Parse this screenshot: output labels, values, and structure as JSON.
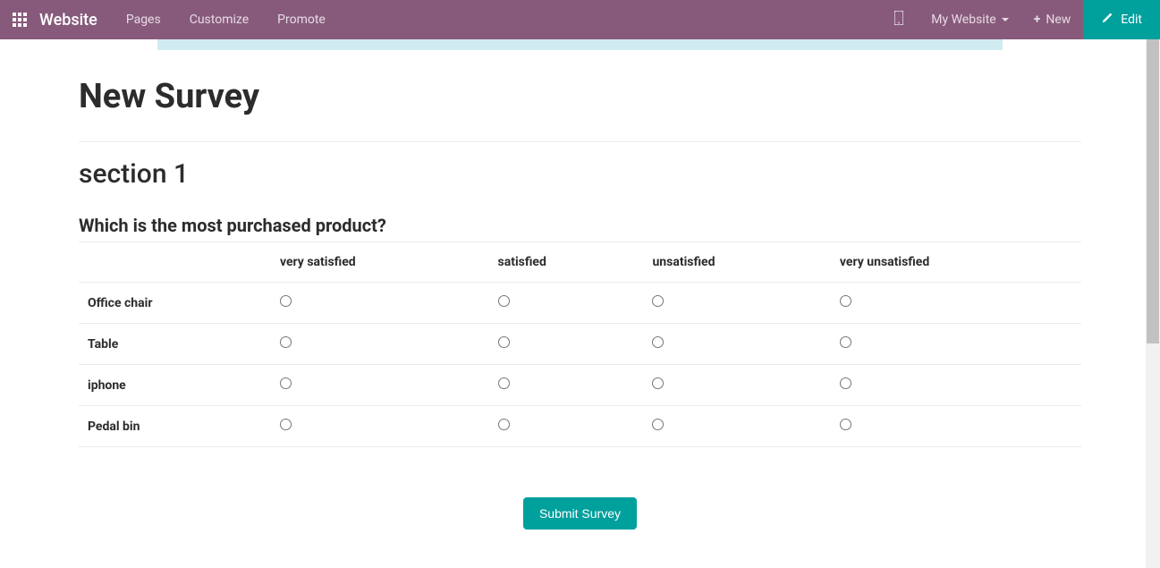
{
  "topbar": {
    "app_title": "Website",
    "nav": [
      "Pages",
      "Customize",
      "Promote"
    ],
    "website_selector": "My Website",
    "new_label": "New",
    "edit_label": "Edit"
  },
  "survey": {
    "title": "New Survey",
    "section_title": "section 1",
    "question": "Which is the most purchased product?",
    "columns": [
      "very satisfied",
      "satisfied",
      "unsatisfied",
      "very unsatisfied"
    ],
    "rows": [
      "Office chair",
      "Table",
      "iphone",
      "Pedal bin"
    ],
    "submit_label": "Submit Survey"
  }
}
